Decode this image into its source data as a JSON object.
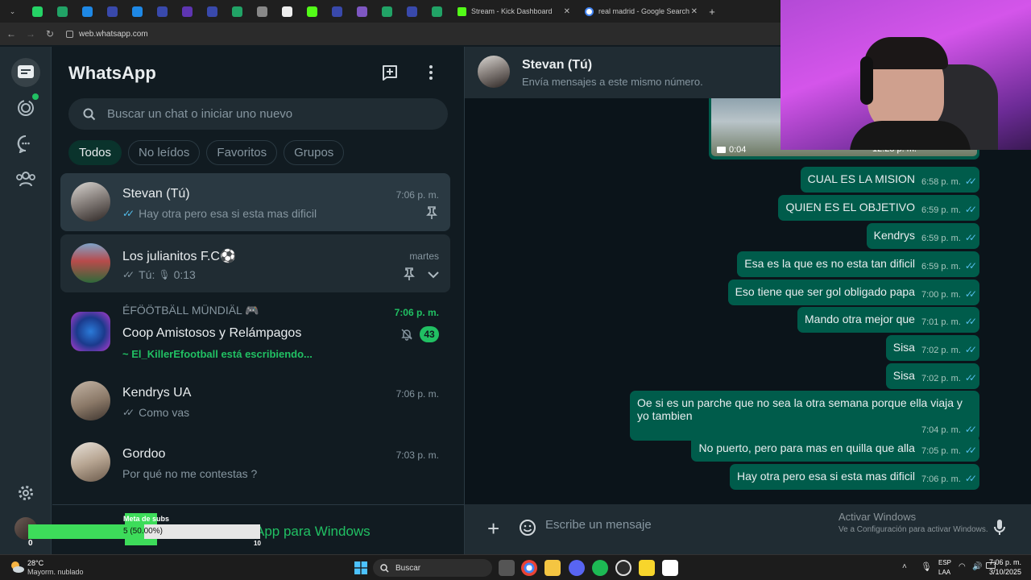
{
  "browser": {
    "tabs": [
      {
        "title": "Stream - Kick Dashboard",
        "icon": "kick-icon",
        "color": "#53fc18"
      },
      {
        "title": "real madrid - Google Search",
        "icon": "google-icon",
        "color": "#4285f4"
      }
    ],
    "pinned_tab_colors": [
      "#25d366",
      "#21a366",
      "#1e88e5",
      "#3949ab",
      "#1e88e5",
      "#3949ab",
      "#5e35b1",
      "#3949ab",
      "#21a366",
      "#888888",
      "#eeeeee",
      "#53fc18",
      "#3949ab",
      "#7e57c2",
      "#21a366",
      "#3949ab",
      "#21a366"
    ],
    "new_tab": "+",
    "url": "web.whatsapp.com"
  },
  "sidebar": {
    "title": "WhatsApp",
    "search_placeholder": "Buscar un chat o iniciar uno nuevo",
    "filters": [
      "Todos",
      "No leídos",
      "Favoritos",
      "Grupos"
    ],
    "get_app": "App para Windows"
  },
  "chats": [
    {
      "name": "Stevan (Tú)",
      "time": "7:06 p. m.",
      "preview": "Hay otra pero esa si esta mas dificil",
      "ticks": "✓✓"
    },
    {
      "name": "Los julianitos F.C⚽",
      "time": "martes",
      "preview_prefix": "Tú:",
      "preview": "0:13",
      "ticks": "✓✓"
    },
    {
      "group": "ÉFÖÖTBÄLL MÜNDIÄL 🎮",
      "name": "Coop Amistosos y Relámpagos",
      "time": "7:06 p. m.",
      "preview": "~ El_KillerEfootball está escribiendo...",
      "badge": "43"
    },
    {
      "name": "Kendrys UA",
      "time": "7:06 p. m.",
      "preview": "Como vas",
      "ticks": "✓✓"
    },
    {
      "name": "Gordoo",
      "time": "7:03 p. m.",
      "preview": "Por qué no me contestas ?"
    }
  ],
  "conversation": {
    "name": "Stevan (Tú)",
    "subtitle": "Envía mensajes a este mismo número.",
    "video": {
      "duration": "0:04",
      "time": "12:28 p. m."
    },
    "messages": [
      {
        "text": "CUAL ES LA MISION",
        "time": "6:58 p. m."
      },
      {
        "text": "QUIEN ES EL OBJETIVO",
        "time": "6:59 p. m."
      },
      {
        "text": "Kendrys",
        "time": "6:59 p. m."
      },
      {
        "text": "Esa es la que es no esta tan dificil",
        "time": "6:59 p. m."
      },
      {
        "text": "Eso tiene que ser gol obligado papa",
        "time": "7:00 p. m."
      },
      {
        "text": "Mando otra mejor que",
        "time": "7:01 p. m."
      },
      {
        "text": "Sisa",
        "time": "7:02 p. m."
      },
      {
        "text": "Sisa",
        "time": "7:02 p. m."
      },
      {
        "text": "Oe si es un parche que no sea la otra semana porque ella viaja y yo tambien",
        "time": "7:04 p. m."
      },
      {
        "text": "No puerto, pero para mas en quilla que alla",
        "time": "7:05 p. m."
      },
      {
        "text": "Hay otra pero esa si esta mas dificil",
        "time": "7:06 p. m."
      }
    ],
    "composer_placeholder": "Escribe un mensaje",
    "activate_title": "Activar Windows",
    "activate_sub": "Ve a Configuración para activar Windows."
  },
  "sub_goal": {
    "title": "Meta de subs",
    "progress_text": "5 (50.00%)",
    "progress": 0.5,
    "min": "0",
    "max": "10"
  },
  "taskbar": {
    "weather_temp": "28°C",
    "weather_desc": "Mayorm. nublado",
    "search": "Buscar",
    "lang_top": "ESP",
    "lang_bottom": "LAA",
    "time": "7:06 p. m.",
    "date": "3/10/2025"
  }
}
